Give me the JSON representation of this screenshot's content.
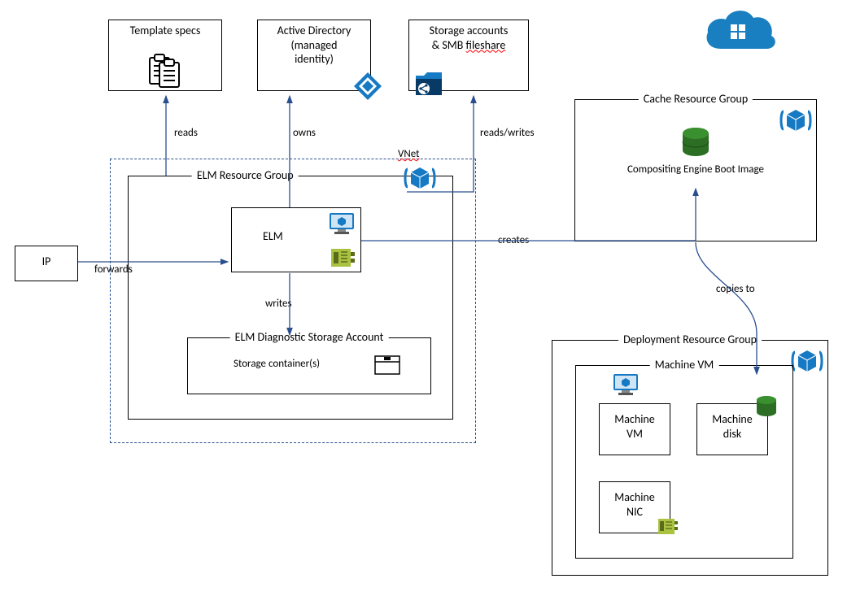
{
  "azure_label": "Azure",
  "boxes": {
    "template_specs": "Template specs",
    "active_directory_l1": "Active Directory",
    "active_directory_l2": "(managed",
    "active_directory_l3": "identity)",
    "storage_accounts_l1": "Storage accounts",
    "storage_accounts_l2_a": "& SMB ",
    "storage_accounts_l2_b": "fileshare",
    "ip": "IP",
    "elm_rg": "ELM Resource Group",
    "vnet": "VNet",
    "elm": "ELM",
    "elm_diag": "ELM Diagnostic Storage Account",
    "storage_containers": "Storage container(s)",
    "cache_rg": "Cache Resource Group",
    "boot_image": "Compositing Engine Boot Image",
    "deploy_rg": "Deployment Resource Group",
    "machine_vm_group": "Machine VM",
    "machine_vm": "Machine\nVM",
    "machine_disk": "Machine\ndisk",
    "machine_nic": "Machine\nNIC"
  },
  "connectors": {
    "forwards": "forwards",
    "reads": "reads",
    "owns": "owns",
    "reads_writes": "reads/writes",
    "writes": "writes",
    "creates": "creates",
    "copies_to": "copies to"
  },
  "colors": {
    "arrow": "#2a4f8f",
    "azure_blue": "#1a7fc1",
    "azure_dark": "#0a5a96",
    "cube_blue": "#1679c4",
    "green": "#3a8f2f",
    "green_dark": "#2c6f24",
    "yellowgreen": "#a9c23f"
  }
}
